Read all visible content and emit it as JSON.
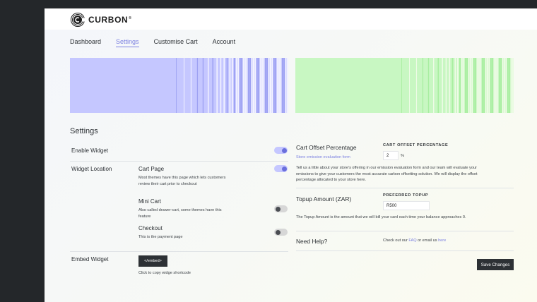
{
  "brand": {
    "name": "CURBON",
    "tm": "®"
  },
  "nav": {
    "items": [
      {
        "label": "Dashboard",
        "active": false
      },
      {
        "label": "Settings",
        "active": true
      },
      {
        "label": "Customise Cart",
        "active": false
      },
      {
        "label": "Account",
        "active": false
      }
    ]
  },
  "colors": {
    "accent": "#7a7fe0",
    "banner_left": "#c5c7ff",
    "banner_right": "#c8f7c2",
    "dark_button": "#2d3135"
  },
  "settings": {
    "title": "Settings",
    "enable_widget": {
      "label": "Enable Widget",
      "on": true
    },
    "widget_location": {
      "label": "Widget Location",
      "options": [
        {
          "title": "Cart Page",
          "description": "Most themes have this page which lets customers review their cart prior to checkout",
          "on": true
        },
        {
          "title": "Mini Cart",
          "description": "Also called drawer-cart, some themes have this feature",
          "on": false
        },
        {
          "title": "Checkout",
          "description": "This is the payment page",
          "on": false
        }
      ]
    },
    "embed_widget": {
      "label": "Embed Widget",
      "button": "</embed>",
      "caption": "Click to copy widge shortcode"
    }
  },
  "offset": {
    "title": "Cart Offset Percentage",
    "link": "Store emission evaluation form",
    "field_caption": "Cart Offset Percentage",
    "value": "2",
    "unit": "%",
    "description": "Tell us a little about your store's offering in our emission evaluation form and our team will evaluate your emissions to give your customers the most accurate carbon offsetting solution.  We will display the offset percentage allocated to your store here."
  },
  "topup": {
    "title": "Topup Amount (ZAR)",
    "field_caption": "Preferred Topup",
    "value": "R500",
    "description": "The Topup Amount is the amount that we will bill your card each time your balance approaches 0."
  },
  "help": {
    "title": "Need Help?",
    "text_prefix": "Check out our ",
    "faq": "FAQ",
    "text_mid": " or email us ",
    "here": "here"
  },
  "save_button": "Save Changes"
}
